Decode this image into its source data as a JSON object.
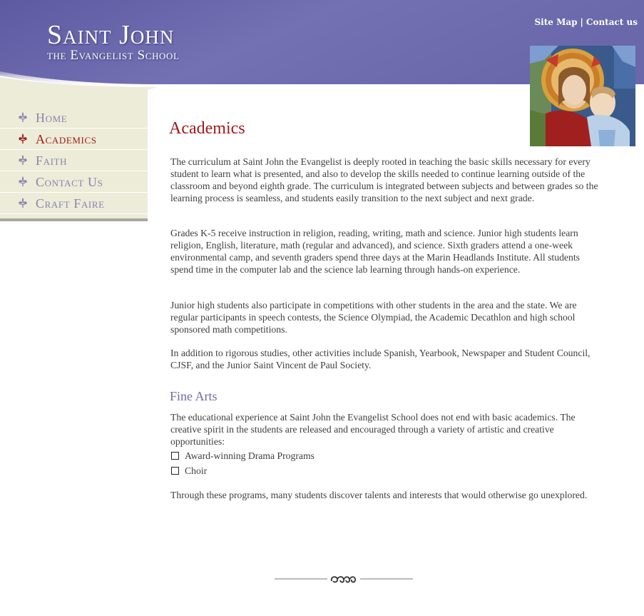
{
  "header": {
    "title": "Saint John",
    "subtitle": "the Evangelist School",
    "links": [
      {
        "label": "Site Map"
      },
      {
        "label": "Contact us"
      }
    ],
    "link_separator": "|",
    "band_color": "#6a67ab",
    "band_color_light": "#8b88c4"
  },
  "sidebar": {
    "items": [
      {
        "label": "Home",
        "active": false
      },
      {
        "label": "Academics",
        "active": true
      },
      {
        "label": "Faith",
        "active": false
      },
      {
        "label": "Contact Us",
        "active": false
      },
      {
        "label": "Craft Faire",
        "active": false
      }
    ],
    "bg_color": "#ececd8",
    "inactive_color": "#8683b0",
    "active_color": "#a0191a"
  },
  "main": {
    "title": "Academics",
    "paragraphs": [
      "The curriculum at Saint John the Evangelist is deeply rooted in teaching the basic skills necessary for every student to learn what is presented, and also to develop the skills needed to continue learning outside of the classroom and beyond eighth grade.  The curriculum is integrated between subjects and between grades so the learning process is seamless, and students easily transition to the next subject and next grade.",
      "Grades K-5 receive instruction in religion, reading, writing, math and science.  Junior high students learn religion, English, literature, math (regular and advanced), and science.  Sixth graders attend a one-week environmental camp, and seventh graders spend three days at the Marin Headlands Institute.  All students spend time in the computer lab and the science lab learning through hands-on experience.",
      "Junior high students also participate in competitions with other students in the area and the state.  We are regular participants in speech contests, the Science Olympiad, the Academic Decathlon and high school sponsored math competitions.",
      "In addition to rigorous studies, other activities include Spanish, Yearbook, Newspaper and Student Council, CJSF, and the Junior Saint Vincent de Paul Society."
    ],
    "section": {
      "heading": "Fine Arts",
      "intro": "The educational experience at Saint John the Evangelist School does not end with basic academics.  The creative spirit in the students are released and encouraged through a variety of artistic and creative opportunities:",
      "list": [
        "Award-winning Drama Programs",
        "Choir"
      ],
      "outro": "Through these programs, many students discover talents and interests that would otherwise go unexplored."
    }
  },
  "icons": {
    "nav_icon": "fleur-de-lis-icon",
    "list_bullet": "square-box-icon",
    "footer": "ornament-divider-icon"
  }
}
